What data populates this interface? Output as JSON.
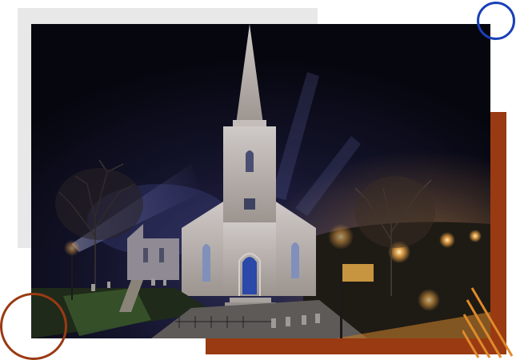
{
  "image": {
    "subject": "church-at-night",
    "colors": {
      "sky": "#090914",
      "stone": "#b9b2b0",
      "door": "#2a49a8",
      "window": "#7f8fb8",
      "light_glow": "#ffb04a",
      "grass": "#3b5a2c"
    }
  },
  "decorations": {
    "accent_blue": "#1a3fb8",
    "accent_rust": "#9a3a12",
    "panel_grey": "#e8e8e8",
    "stripe_orange": "#e08a2a"
  }
}
